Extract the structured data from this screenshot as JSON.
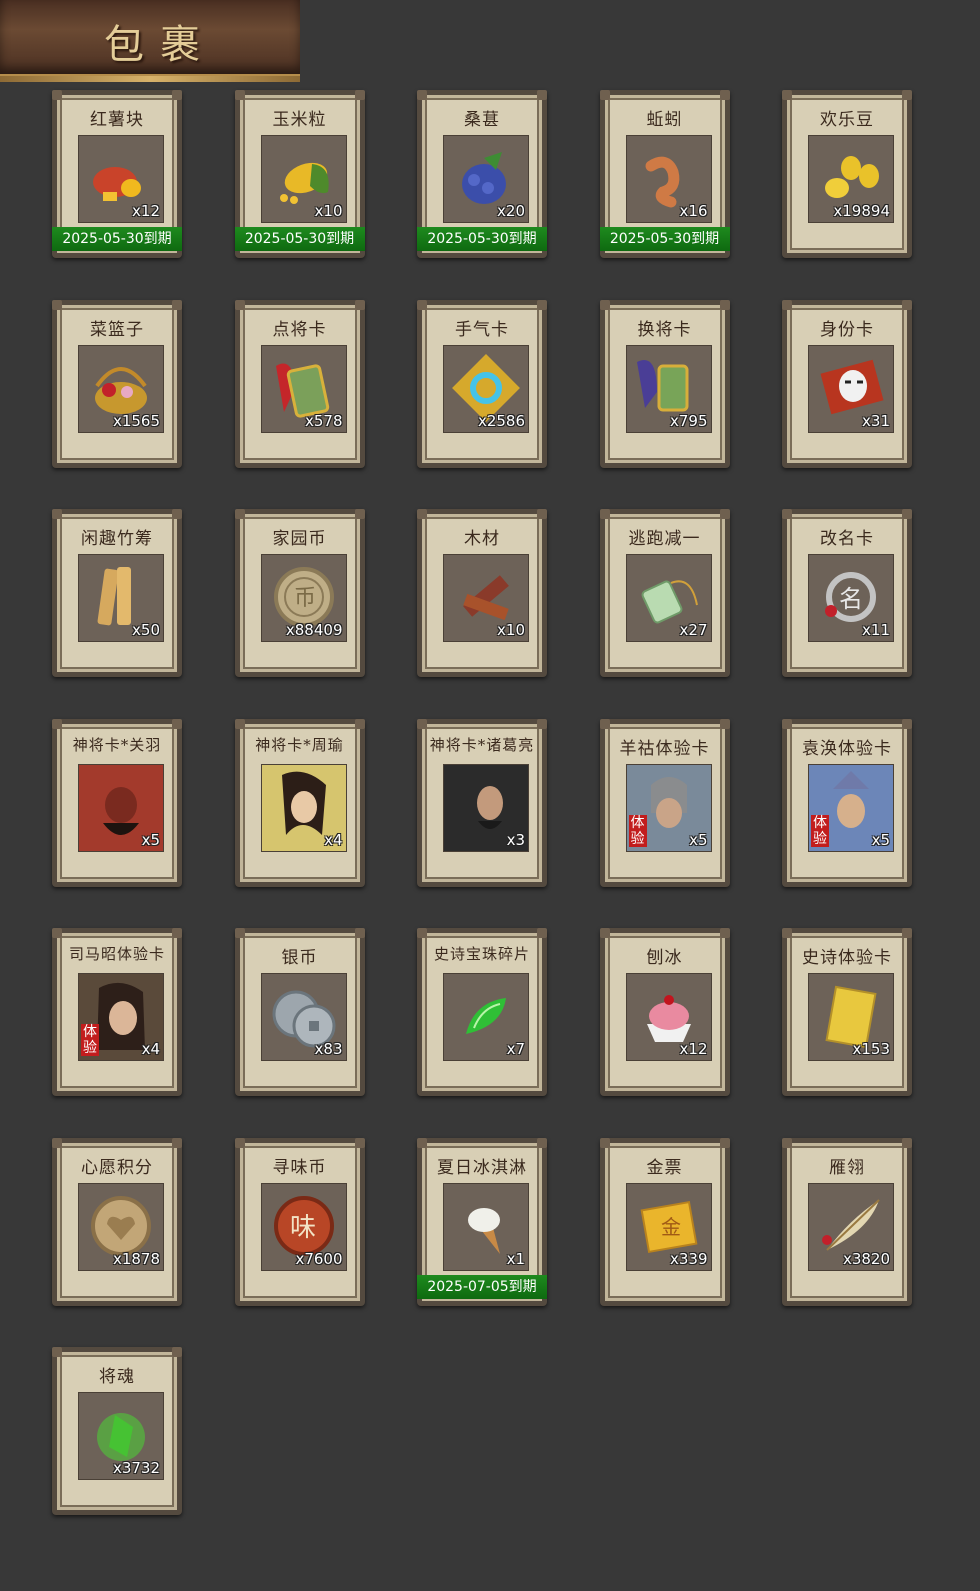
{
  "header": {
    "title": "包裹"
  },
  "items": [
    {
      "name": "红薯块",
      "count": "x12",
      "expire": "2025-05-30到期",
      "icon": "sweet-potato-icon"
    },
    {
      "name": "玉米粒",
      "count": "x10",
      "expire": "2025-05-30到期",
      "icon": "corn-icon"
    },
    {
      "name": "桑葚",
      "count": "x20",
      "expire": "2025-05-30到期",
      "icon": "mulberry-icon"
    },
    {
      "name": "蚯蚓",
      "count": "x16",
      "expire": "2025-05-30到期",
      "icon": "worm-icon"
    },
    {
      "name": "欢乐豆",
      "count": "x19894",
      "icon": "happy-bean-icon"
    },
    {
      "name": "菜篮子",
      "count": "x1565",
      "icon": "basket-icon"
    },
    {
      "name": "点将卡",
      "count": "x578",
      "icon": "general-pick-card-icon"
    },
    {
      "name": "手气卡",
      "count": "x2586",
      "icon": "luck-card-icon"
    },
    {
      "name": "换将卡",
      "count": "x795",
      "icon": "swap-general-card-icon"
    },
    {
      "name": "身份卡",
      "count": "x31",
      "icon": "identity-card-icon"
    },
    {
      "name": "闲趣竹筹",
      "count": "x50",
      "icon": "bamboo-token-icon"
    },
    {
      "name": "家园币",
      "count": "x88409",
      "icon": "home-coin-icon"
    },
    {
      "name": "木材",
      "count": "x10",
      "icon": "wood-icon"
    },
    {
      "name": "逃跑减一",
      "count": "x27",
      "icon": "escape-minus-one-icon"
    },
    {
      "name": "改名卡",
      "count": "x11",
      "icon": "rename-card-icon"
    },
    {
      "name": "神将卡*关羽",
      "count": "x5",
      "icon": "guan-yu-portrait-icon",
      "portrait": true
    },
    {
      "name": "神将卡*周瑜",
      "count": "x4",
      "icon": "zhou-yu-portrait-icon",
      "portrait": true
    },
    {
      "name": "神将卡*诸葛亮",
      "count": "x3",
      "icon": "zhuge-liang-portrait-icon",
      "portrait": true
    },
    {
      "name": "羊祜体验卡",
      "count": "x5",
      "icon": "yang-hu-portrait-icon",
      "portrait": true,
      "trial": "体验"
    },
    {
      "name": "袁涣体验卡",
      "count": "x5",
      "icon": "yuan-huan-portrait-icon",
      "portrait": true,
      "trial": "体验"
    },
    {
      "name": "司马昭体验卡",
      "count": "x4",
      "icon": "sima-zhao-portrait-icon",
      "portrait": true,
      "trial": "体验"
    },
    {
      "name": "银币",
      "count": "x83",
      "icon": "silver-coin-icon"
    },
    {
      "name": "史诗宝珠碎片",
      "count": "x7",
      "icon": "epic-gem-shard-icon"
    },
    {
      "name": "刨冰",
      "count": "x12",
      "icon": "shaved-ice-icon"
    },
    {
      "name": "史诗体验卡",
      "count": "x153",
      "icon": "epic-trial-card-icon"
    },
    {
      "name": "心愿积分",
      "count": "x1878",
      "icon": "wish-point-icon"
    },
    {
      "name": "寻味币",
      "count": "x7600",
      "icon": "taste-coin-icon"
    },
    {
      "name": "夏日冰淇淋",
      "count": "x1",
      "expire": "2025-07-05到期",
      "icon": "ice-cream-icon"
    },
    {
      "name": "金票",
      "count": "x339",
      "icon": "gold-ticket-icon"
    },
    {
      "name": "雁翎",
      "count": "x3820",
      "icon": "feather-icon"
    },
    {
      "name": "将魂",
      "count": "x3732",
      "icon": "general-soul-icon"
    }
  ],
  "colors": {
    "background": "#383838",
    "card": "#d8cfb5",
    "expire_banner": "#1e8a1e",
    "title_text": "#e4cd98"
  }
}
